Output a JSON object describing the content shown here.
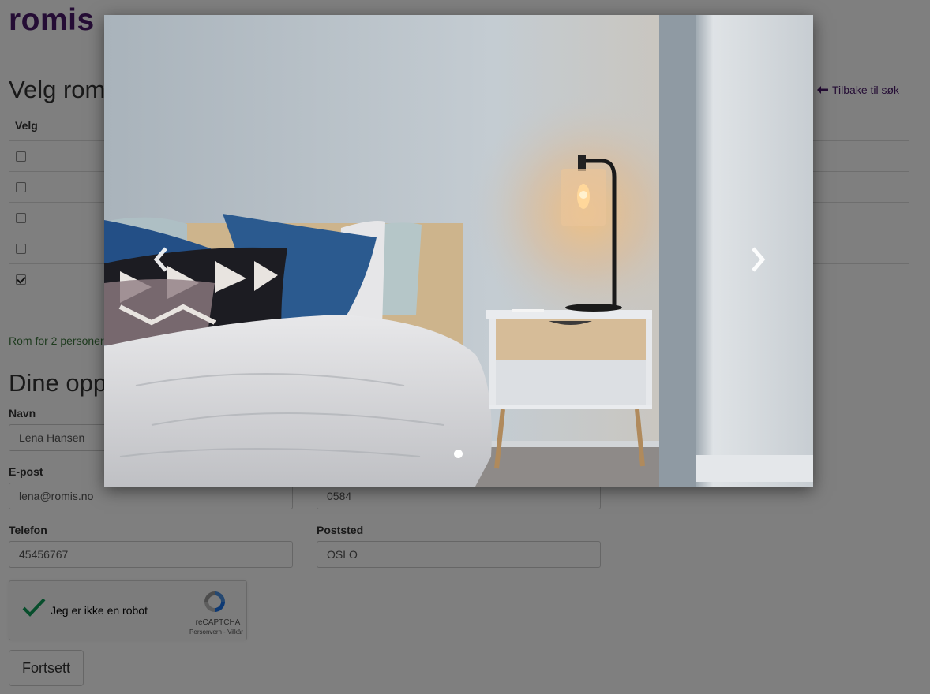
{
  "brand": {
    "name": "romis",
    "color": "#4a1b6b"
  },
  "rooms": {
    "heading": "Velg rom",
    "back_link": "Tilbake til søk",
    "col_select": "Velg",
    "rows": [
      {
        "checked": false
      },
      {
        "checked": false
      },
      {
        "checked": false
      },
      {
        "checked": false
      },
      {
        "checked": true
      }
    ],
    "note": "Rom for 2 personer"
  },
  "details": {
    "heading": "Dine opp",
    "name_label": "Navn",
    "name_value": "Lena Hansen",
    "email_label": "E-post",
    "email_value": "lena@romis.no",
    "postcode_value": "0584",
    "phone_label": "Telefon",
    "phone_value": "45456767",
    "city_label": "Poststed",
    "city_value": "OSLO"
  },
  "captcha": {
    "label": "Jeg er ikke en robot",
    "brand": "reCAPTCHA",
    "links": "Personvern - Vilkår"
  },
  "continue_button": "Fortsett",
  "lightbox": {
    "prev_icon": "chevron-left-icon",
    "next_icon": "chevron-right-icon",
    "slides": 1,
    "active_slide": 1
  },
  "colors": {
    "link": "#4a1b6b",
    "note": "#3c763d",
    "check_green": "#0f9d58"
  }
}
